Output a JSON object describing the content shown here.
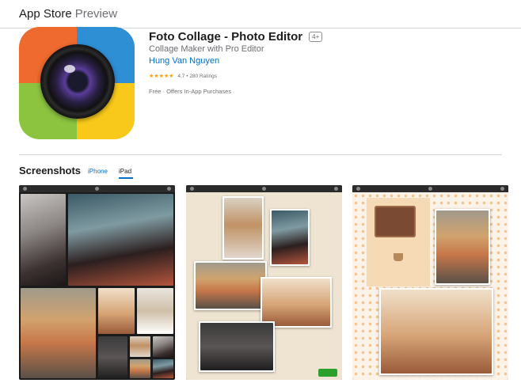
{
  "header": {
    "brand": "App Store",
    "subbrand": "Preview"
  },
  "app": {
    "title": "Foto Collage - Photo Editor",
    "age_rating": "4+",
    "subtitle": "Collage Maker with Pro Editor",
    "developer": "Hung Van Nguyen",
    "stars": "★★★★★",
    "rating_value": 4.7,
    "rating_text": "4.7 • 280 Ratings",
    "price": "Free · Offers In-App Purchases",
    "icon": "camera-lens-icon",
    "icon_colors": [
      "#ee6a2f",
      "#2f8fd5",
      "#8cc43f",
      "#f8c91b"
    ]
  },
  "screenshots": {
    "title": "Screenshots",
    "tabs": [
      {
        "label": "iPhone",
        "selected": false
      },
      {
        "label": "iPad",
        "selected": true
      }
    ],
    "count": 3
  },
  "colors": {
    "link": "#0070c9",
    "star": "#ff9f0a",
    "text": "#1d1d1f",
    "secondary": "#6e6e73"
  }
}
